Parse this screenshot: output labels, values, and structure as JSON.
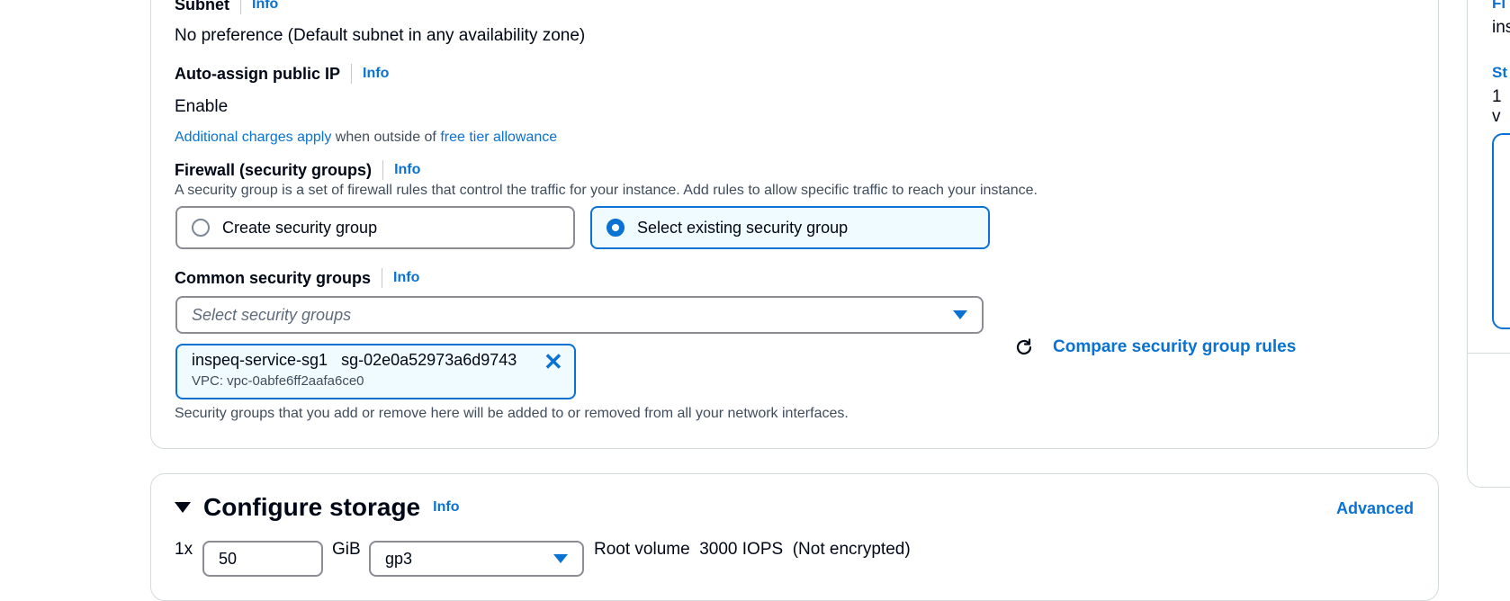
{
  "network": {
    "subnet": {
      "label": "Subnet",
      "info": "Info",
      "value": "No preference (Default subnet in any availability zone)"
    },
    "public_ip": {
      "label": "Auto-assign public IP",
      "info": "Info",
      "value": "Enable"
    },
    "charges": {
      "link1": "Additional charges apply",
      "middle": "when outside of",
      "link2": "free tier allowance"
    },
    "firewall": {
      "label": "Firewall (security groups)",
      "info": "Info",
      "description": "A security group is a set of firewall rules that control the traffic for your instance. Add rules to allow specific traffic to reach your instance.",
      "options": [
        {
          "label": "Create security group",
          "selected": false
        },
        {
          "label": "Select existing security group",
          "selected": true
        }
      ]
    },
    "common_sg": {
      "label": "Common security groups",
      "info": "Info",
      "placeholder": "Select security groups",
      "token": {
        "name": "inspeq-service-sg1",
        "id": "sg-02e0a52973a6d9743",
        "vpc": "VPC: vpc-0abfe6ff2aafa6ce0"
      },
      "compare_label": "Compare security group rules",
      "note": "Security groups that you add or remove here will be added to or removed from all your network interfaces."
    }
  },
  "storage": {
    "title": "Configure storage",
    "info": "Info",
    "advanced": "Advanced",
    "multiplier": "1x",
    "size": "50",
    "unit": "GiB",
    "type": "gp3",
    "desc": "Root volume  3000 IOPS  (Not encrypted)"
  },
  "summary_partial": {
    "line1": "Fi",
    "line2": "ins",
    "line3": "St",
    "line4": "1 v"
  },
  "colors": {
    "accent": "#0972d3",
    "text": "#000716",
    "muted": "#414d5c"
  }
}
